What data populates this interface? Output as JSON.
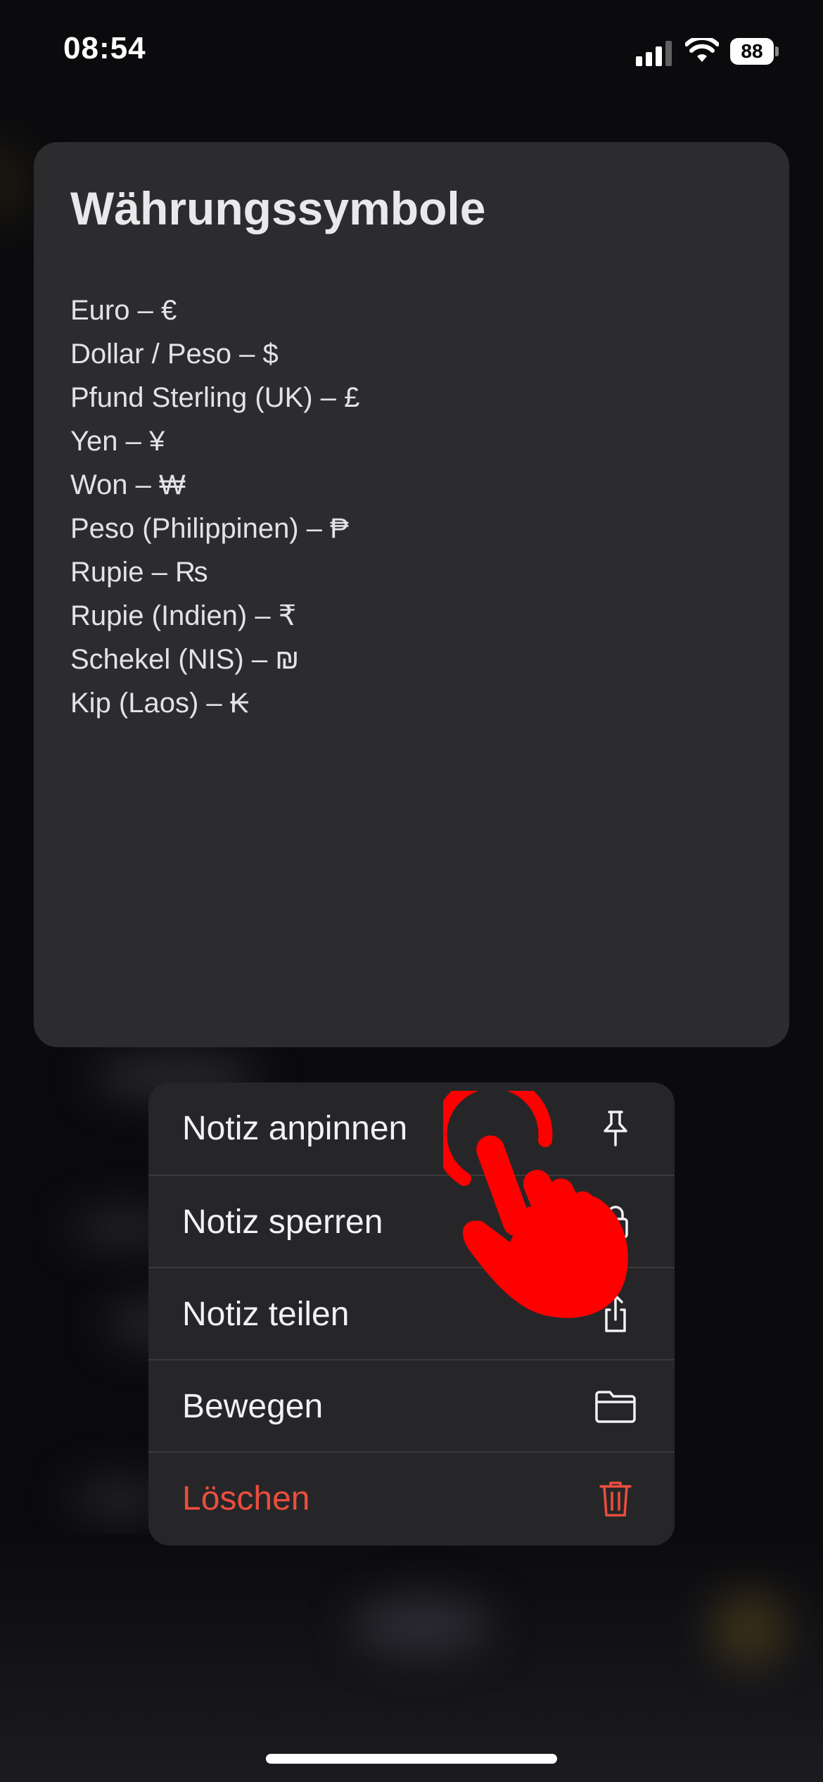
{
  "status_bar": {
    "time": "08:54",
    "battery_level": "88",
    "signal_icon": "cellular-signal-icon",
    "wifi_icon": "wifi-icon"
  },
  "note": {
    "title": "Währungssymbole",
    "lines": [
      "Euro – €",
      "Dollar / Peso – $",
      "Pfund Sterling (UK) – £",
      "Yen – ¥",
      "Won – ₩",
      "Peso (Philippinen) – ₱",
      "Rupie – ₨",
      "Rupie (Indien) – ₹",
      "Schekel (NIS) – ₪",
      "Kip (Laos) – ₭"
    ]
  },
  "context_menu": {
    "items": [
      {
        "label": "Notiz anpinnen",
        "icon": "pin-icon"
      },
      {
        "label": "Notiz sperren",
        "icon": "lock-icon"
      },
      {
        "label": "Notiz teilen",
        "icon": "share-icon"
      },
      {
        "label": "Bewegen",
        "icon": "folder-icon"
      },
      {
        "label": "Löschen",
        "icon": "trash-icon"
      }
    ]
  },
  "colors": {
    "danger": "#eb4e3d",
    "card_background": "#2c2c2e",
    "menu_background": "#262628",
    "tap_hand": "#ff0000"
  }
}
